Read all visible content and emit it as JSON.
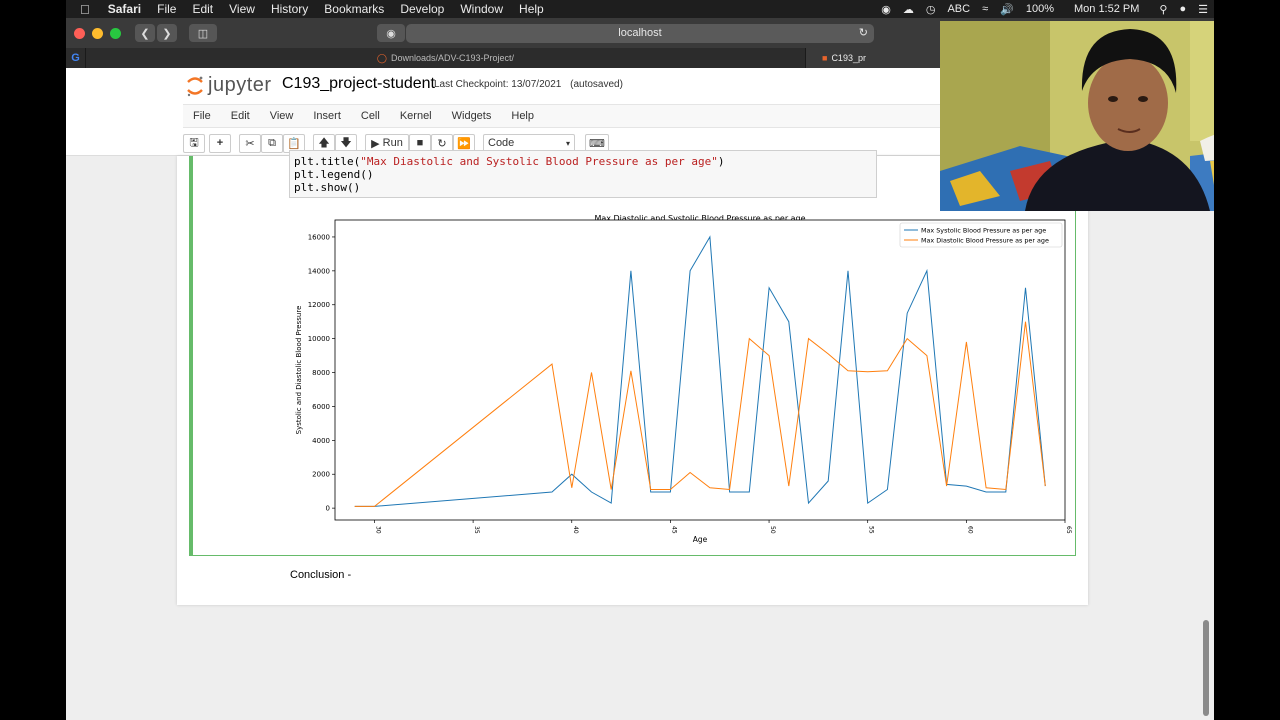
{
  "menubar": {
    "app": "Safari",
    "items": [
      "File",
      "Edit",
      "View",
      "History",
      "Bookmarks",
      "Develop",
      "Window",
      "Help"
    ],
    "status": {
      "input": "ABC",
      "battery": "100%",
      "clock": "Mon 1:52 PM"
    }
  },
  "browser": {
    "address": "localhost",
    "tabs": [
      {
        "label": "Downloads/ADV-C193-Project/"
      },
      {
        "label": "C193_pr"
      }
    ]
  },
  "jupyter": {
    "logo": "jupyter",
    "notebook_title": "C193_project-student",
    "checkpoint": "Last Checkpoint: 13/07/2021",
    "autosave": "(autosaved)",
    "menu": [
      "File",
      "Edit",
      "View",
      "Insert",
      "Cell",
      "Kernel",
      "Widgets",
      "Help"
    ],
    "toolbar": {
      "run_label": "Run",
      "cell_type": "Code"
    }
  },
  "code_cell": {
    "line1_prefix": "plt.title(",
    "line1_string": "\"Max Diastolic and Systolic Blood Pressure as per age\"",
    "line1_suffix": ")",
    "line2": "plt.legend()",
    "line3": "plt.show()"
  },
  "markdown": {
    "conclusion": "Conclusion -"
  },
  "chart_data": {
    "type": "line",
    "title": "Max Diastolic and Systolic Blood Pressure as per age",
    "xlabel": "Age",
    "ylabel": "Systolic and Diastolic Blood Pressure",
    "xlim": [
      28,
      65
    ],
    "ylim": [
      -700,
      17000
    ],
    "xticks": [
      30,
      35,
      40,
      45,
      50,
      55,
      60,
      65
    ],
    "yticks": [
      0,
      2000,
      4000,
      6000,
      8000,
      10000,
      12000,
      14000,
      16000
    ],
    "legend_position": "top-right",
    "grid": false,
    "series": [
      {
        "name": "Max Systolic Blood Pressure as per age",
        "color": "#1f77b4",
        "points": [
          [
            29,
            100
          ],
          [
            30,
            100
          ],
          [
            39,
            950
          ],
          [
            40,
            2000
          ],
          [
            41,
            950
          ],
          [
            42,
            300
          ],
          [
            43,
            14000
          ],
          [
            44,
            950
          ],
          [
            45,
            950
          ],
          [
            46,
            14000
          ],
          [
            47,
            16000
          ],
          [
            48,
            950
          ],
          [
            49,
            950
          ],
          [
            50,
            13000
          ],
          [
            51,
            11000
          ],
          [
            52,
            300
          ],
          [
            53,
            1600
          ],
          [
            54,
            14000
          ],
          [
            55,
            300
          ],
          [
            56,
            1100
          ],
          [
            57,
            11500
          ],
          [
            58,
            14000
          ],
          [
            59,
            1400
          ],
          [
            60,
            1300
          ],
          [
            61,
            950
          ],
          [
            62,
            950
          ],
          [
            63,
            13000
          ],
          [
            64,
            1300
          ]
        ]
      },
      {
        "name": "Max Diastolic Blood Pressure as per age",
        "color": "#ff7f0e",
        "points": [
          [
            29,
            100
          ],
          [
            30,
            100
          ],
          [
            39,
            8500
          ],
          [
            40,
            1200
          ],
          [
            41,
            8000
          ],
          [
            42,
            1100
          ],
          [
            43,
            8100
          ],
          [
            44,
            1100
          ],
          [
            45,
            1100
          ],
          [
            46,
            2100
          ],
          [
            47,
            1200
          ],
          [
            48,
            1100
          ],
          [
            49,
            10000
          ],
          [
            50,
            9000
          ],
          [
            51,
            1300
          ],
          [
            52,
            10000
          ],
          [
            53,
            9100
          ],
          [
            54,
            8100
          ],
          [
            55,
            8050
          ],
          [
            56,
            8100
          ],
          [
            57,
            10000
          ],
          [
            58,
            9000
          ],
          [
            59,
            1300
          ],
          [
            60,
            9800
          ],
          [
            61,
            1200
          ],
          [
            62,
            1100
          ],
          [
            63,
            11000
          ],
          [
            64,
            1300
          ]
        ]
      }
    ]
  }
}
